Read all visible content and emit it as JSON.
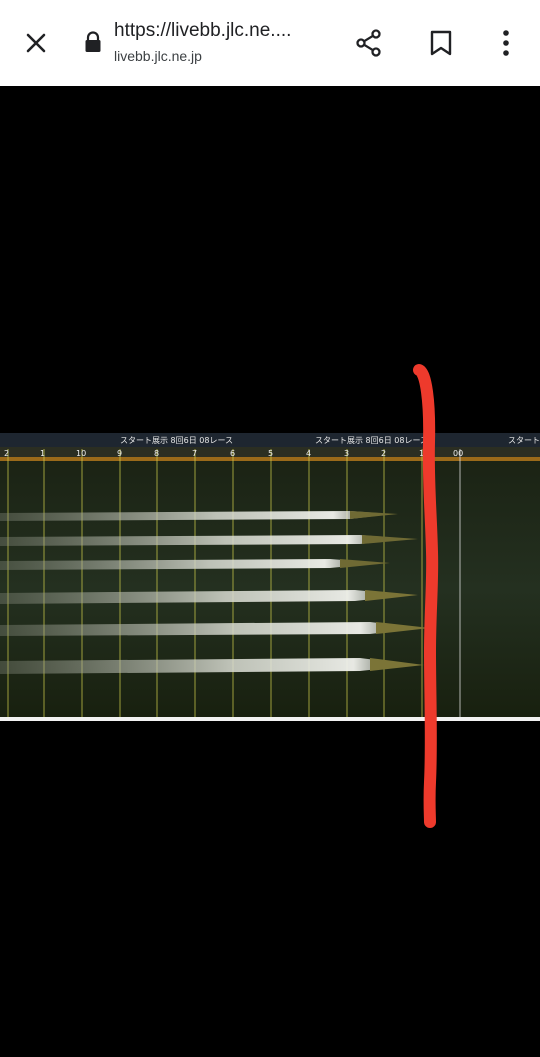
{
  "browser": {
    "url_title": "https://livebb.jlc.ne....",
    "domain": "livebb.jlc.ne.jp",
    "icons": {
      "close": "close-icon",
      "lock": "lock-icon",
      "share": "share-icon",
      "bookmark": "bookmark-icon",
      "more": "more-vert-icon"
    }
  },
  "image": {
    "ticker_text_1": "スタート展示 8回6日 08レース",
    "ticker_text_2": "スタート展示 8回6日 08レース",
    "ticker_text_3": "スタート",
    "tick_labels": [
      "2",
      "1",
      "10",
      "9",
      "8",
      "7",
      "6",
      "5",
      "4",
      "3",
      "2",
      "1",
      "00"
    ],
    "colors": {
      "water": "#1f2a1a",
      "grid_line": "#c9c84a",
      "wake": "#e6e8e0",
      "annotation": "#ee3a2c"
    }
  }
}
